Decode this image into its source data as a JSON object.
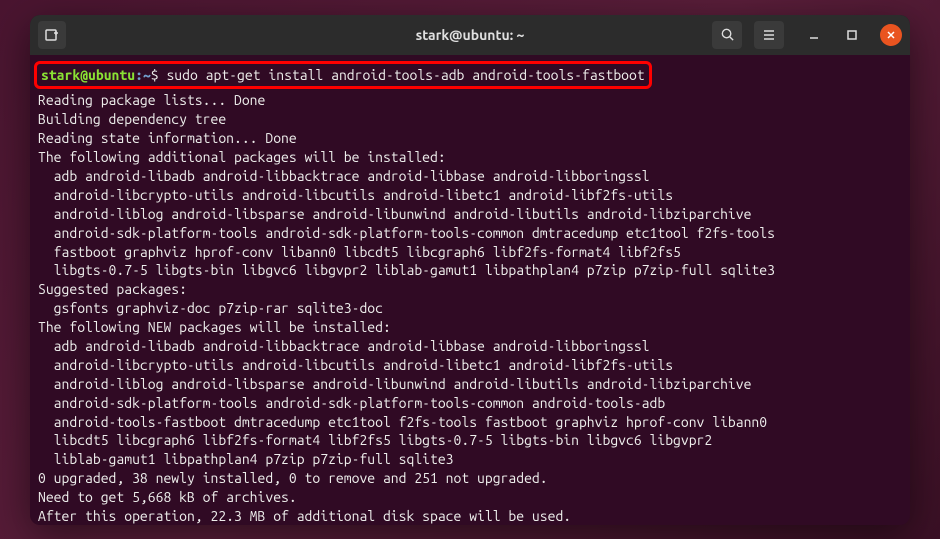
{
  "window": {
    "title": "stark@ubuntu: ~"
  },
  "prompt": {
    "user_host": "stark@ubuntu",
    "separator": ":",
    "path": "~",
    "dollar": "$",
    "command": " sudo apt-get install android-tools-adb android-tools-fastboot"
  },
  "output": {
    "l1": "Reading package lists... Done",
    "l2": "Building dependency tree",
    "l3": "Reading state information... Done",
    "l4": "The following additional packages will be installed:",
    "l5": "  adb android-libadb android-libbacktrace android-libbase android-libboringssl",
    "l6": "  android-libcrypto-utils android-libcutils android-libetc1 android-libf2fs-utils",
    "l7": "  android-liblog android-libsparse android-libunwind android-libutils android-libziparchive",
    "l8": "  android-sdk-platform-tools android-sdk-platform-tools-common dmtracedump etc1tool f2fs-tools",
    "l9": "  fastboot graphviz hprof-conv libann0 libcdt5 libcgraph6 libf2fs-format4 libf2fs5",
    "l10": "  libgts-0.7-5 libgts-bin libgvc6 libgvpr2 liblab-gamut1 libpathplan4 p7zip p7zip-full sqlite3",
    "l11": "Suggested packages:",
    "l12": "  gsfonts graphviz-doc p7zip-rar sqlite3-doc",
    "l13": "The following NEW packages will be installed:",
    "l14": "  adb android-libadb android-libbacktrace android-libbase android-libboringssl",
    "l15": "  android-libcrypto-utils android-libcutils android-libetc1 android-libf2fs-utils",
    "l16": "  android-liblog android-libsparse android-libunwind android-libutils android-libziparchive",
    "l17": "  android-sdk-platform-tools android-sdk-platform-tools-common android-tools-adb",
    "l18": "  android-tools-fastboot dmtracedump etc1tool f2fs-tools fastboot graphviz hprof-conv libann0",
    "l19": "  libcdt5 libcgraph6 libf2fs-format4 libf2fs5 libgts-0.7-5 libgts-bin libgvc6 libgvpr2",
    "l20": "  liblab-gamut1 libpathplan4 p7zip p7zip-full sqlite3",
    "l21": "0 upgraded, 38 newly installed, 0 to remove and 251 not upgraded.",
    "l22": "Need to get 5,668 kB of archives.",
    "l23": "After this operation, 22.3 MB of additional disk space will be used."
  }
}
